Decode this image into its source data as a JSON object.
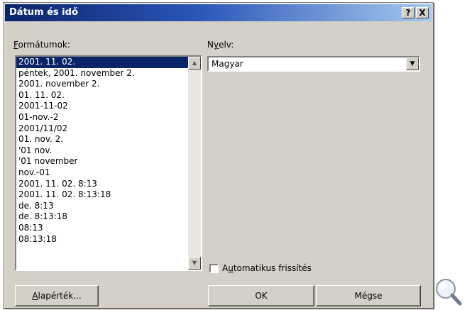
{
  "window": {
    "title": "Dátum és idő"
  },
  "titlebar": {
    "help_label": "?",
    "close_label": "X"
  },
  "formats": {
    "label_prefix": "F",
    "label_rest": "ormátumok:",
    "selected_index": 0,
    "items": [
      "2001. 11. 02.",
      "péntek, 2001. november 2.",
      "2001. november 2.",
      "01. 11. 02.",
      "2001-11-02",
      "01-nov.-2",
      "2001/11/02",
      "01. nov. 2.",
      "'01 nov.",
      "'01 november",
      "nov.-01",
      "2001. 11. 02. 8:13",
      "2001. 11. 02. 8:13:18",
      "de. 8:13",
      "de. 8:13:18",
      "08:13",
      "08:13:18"
    ]
  },
  "language": {
    "label_prefix": "N",
    "label_u": "y",
    "label_rest": "elv:",
    "value": "Magyar"
  },
  "auto_update": {
    "label_prefix": "A",
    "label_u": "u",
    "label_rest": "tomatikus frissítés",
    "checked": false
  },
  "buttons": {
    "defaults_u": "A",
    "defaults_rest": "lapérték...",
    "ok": "OK",
    "cancel": "Mégse"
  },
  "icons": {
    "help": "help-icon",
    "close": "close-icon",
    "scroll_up": "scroll-up-arrow-icon",
    "scroll_down": "scroll-down-arrow-icon",
    "dropdown": "chevron-down-icon",
    "magnifier": "magnifier-icon"
  }
}
